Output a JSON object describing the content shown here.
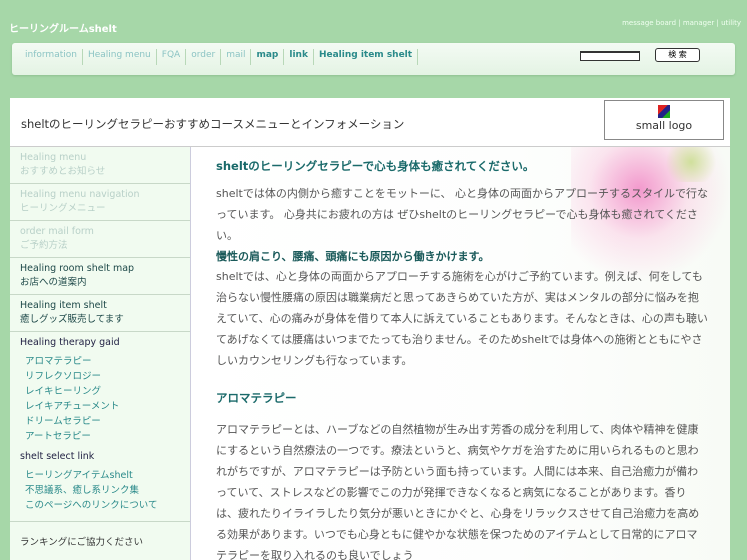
{
  "site_title": "ヒーリングルームshelt",
  "utility_links": "message board | manager | utility",
  "nav": {
    "items": [
      {
        "label": "information",
        "state": "dim"
      },
      {
        "label": "Healing menu",
        "state": "dim"
      },
      {
        "label": "FQA",
        "state": "dim"
      },
      {
        "label": "order",
        "state": "dim"
      },
      {
        "label": "mail",
        "state": "dim"
      },
      {
        "label": "map",
        "state": "on"
      },
      {
        "label": "link",
        "state": "on"
      },
      {
        "label": "Healing item shelt",
        "state": "on"
      }
    ],
    "search_value": "",
    "search_button": "検 索"
  },
  "header": {
    "text": "sheltのヒーリングセラピーおすすめコースメニューとインフォメーション",
    "logo_label": "small logo"
  },
  "sidebar": {
    "blocks": [
      {
        "title": "Healing menu",
        "sub": "おすすめとお知らせ"
      },
      {
        "title": "Healing menu navigation",
        "sub": "ヒーリングメニュー"
      },
      {
        "title": "order mail form",
        "sub": "ご予約方法"
      },
      {
        "title": "Healing room shelt map",
        "sub": "お店への道案内"
      },
      {
        "title": "Healing item shelt",
        "sub": "癒しグッズ販売してます"
      }
    ],
    "therapy_title": "Healing therapy gaid",
    "therapy_links": [
      "アロマテラピー",
      "リフレクソロジー",
      "レイキヒーリング",
      "レイキアチューメント",
      "ドリームセラピー",
      "アートセラピー"
    ],
    "select_title": "shelt select link",
    "select_links": [
      "ヒーリングアイテムshelt",
      "不思議系、癒し系リンク集",
      "このページへのリンクについて"
    ],
    "ranking": "ランキングにご協力ください"
  },
  "main": {
    "heading1": "sheltのヒーリングセラピーで心も身体も癒されてください。",
    "para1": "sheltでは体の内側から癒すことをモットーに、 心と身体の両面からアプローチするスタイルで行なっています。 心身共にお疲れの方は ぜひsheltのヒーリングセラピーで心も身体も癒されてください。",
    "heading2": "慢性の肩こり、腰痛、頭痛にも原因から働きかけます。",
    "para2": "sheltでは、心と身体の両面からアプローチする施術を心がけご予約ています。例えば、何をしても治らない慢性腰痛の原因は職業病だと思ってあきらめていた方が、実はメンタルの部分に悩みを抱えていて、心の痛みが身体を借りて本人に訴えていることもあります。そんなときは、心の声も聴いてあげなくては腰痛はいつまでたっても治りません。そのためsheltでは身体への施術とともにやさしいカウンセリングも行なっています。",
    "heading3": "アロマテラピー",
    "para3": "アロマテラピーとは、ハーブなどの自然植物が生み出す芳香の成分を利用して、肉体や精神を健康にするという自然療法の一つです。療法というと、病気やケガを治すために用いられるものと思われがちですが、アロマテラピーは予防という面も持っています。人間には本来、自己治癒力が備わっていて、ストレスなどの影響でこの力が発揮できなくなると病気になることがあります。香りは、疲れたりイライラしたり気分が悪いときにかぐと、心身をリラックスさせて自己治癒力を高める効果があります。いつでも心身ともに健やかな状態を保つためのアイテムとして日常的にアロマテラピーを取り入れるのも良いでしょう"
  }
}
